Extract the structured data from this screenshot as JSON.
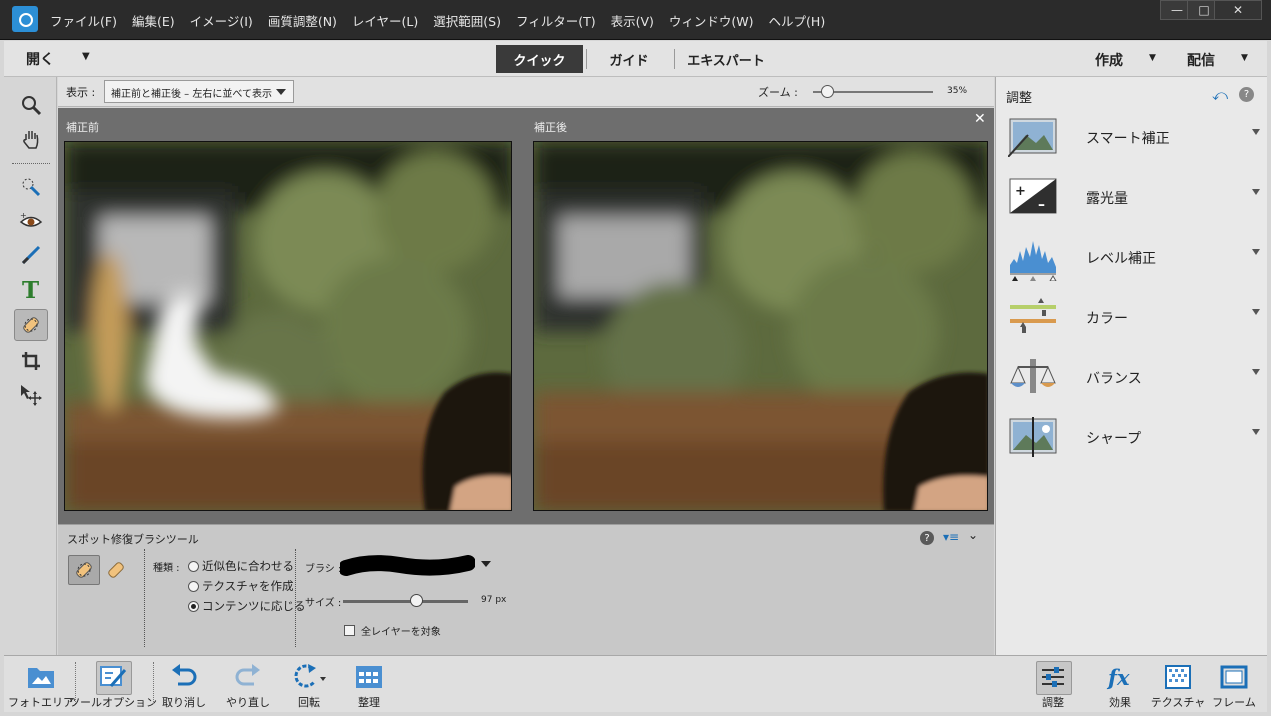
{
  "menu": [
    "ファイル(F)",
    "編集(E)",
    "イメージ(I)",
    "画質調整(N)",
    "レイヤー(L)",
    "選択範囲(S)",
    "フィルター(T)",
    "表示(V)",
    "ウィンドウ(W)",
    "ヘルプ(H)"
  ],
  "window_buttons": {
    "minimize": "—",
    "maximize": "□",
    "close": "✕"
  },
  "modebar": {
    "open": "開く",
    "tabs": {
      "quick": "クイック",
      "guide": "ガイド",
      "expert": "エキスパート"
    },
    "create": "作成",
    "share": "配信"
  },
  "viewbar": {
    "view_label": "表示 :",
    "view_value": "補正前と補正後 – 左右に並べて表示",
    "zoom_label": "ズーム :",
    "zoom_value": "35%",
    "zoom_level_percent": 35
  },
  "canvas": {
    "before_label": "補正前",
    "after_label": "補正後",
    "close": "✕"
  },
  "tool_options": {
    "title": "スポット修復ブラシツール",
    "help": "?",
    "type_label": "種類 :",
    "options": [
      "近似色に合わせる",
      "テクスチャを作成",
      "コンテンツに応じる"
    ],
    "selected_option_index": 2,
    "brush_label": "ブラシ :",
    "size_label": "サイズ :",
    "size_value": "97 px",
    "all_layers": "全レイヤーを対象"
  },
  "panel": {
    "title": "調整",
    "help": "?",
    "items": [
      "スマート補正",
      "露光量",
      "レベル補正",
      "カラー",
      "バランス",
      "シャープ"
    ]
  },
  "bottombar": {
    "left": [
      "フォトエリア",
      "ツールオプション",
      "取り消し",
      "やり直し",
      "回転",
      "整理"
    ],
    "right": [
      "調整",
      "効果",
      "テクスチャ",
      "フレーム"
    ]
  },
  "colors": {
    "accent": "#1b6fb7",
    "titlebar": "#2b2b2b",
    "active_tab": "#3a3a3a"
  }
}
